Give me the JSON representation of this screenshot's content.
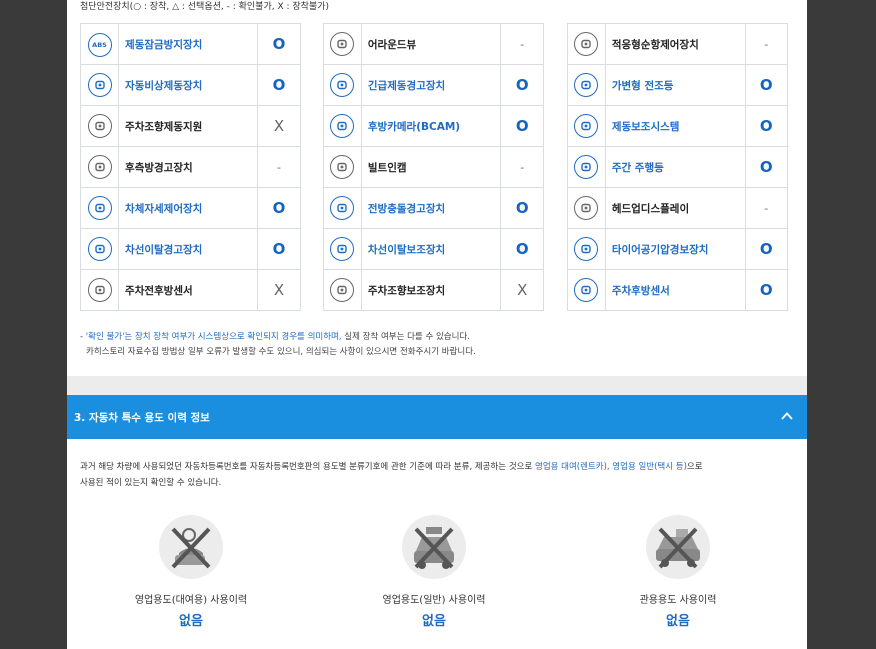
{
  "legend": "첨단안전장치(○ : 장착, △ : 선택옵션, - : 확인불가, X : 장착불가)",
  "columns": [
    [
      {
        "icon": "abs-icon",
        "label": "제동잠금방지장치",
        "status": "O",
        "blue": true
      },
      {
        "icon": "emergency-brake-icon",
        "label": "자동비상제동장치",
        "status": "O",
        "blue": true
      },
      {
        "icon": "steering-wheel-icon",
        "label": "주차조향제동지원",
        "status": "X",
        "blue": false
      },
      {
        "icon": "rear-side-warning-icon",
        "label": "후측방경고장치",
        "status": "-",
        "blue": false
      },
      {
        "icon": "stability-control-icon",
        "label": "차체자세제어장치",
        "status": "O",
        "blue": true
      },
      {
        "icon": "lane-departure-icon",
        "label": "차선이탈경고장치",
        "status": "O",
        "blue": true
      },
      {
        "icon": "parking-sensor-icon",
        "label": "주차전후방센서",
        "status": "X",
        "blue": false
      }
    ],
    [
      {
        "icon": "around-view-icon",
        "label": "어라운드뷰",
        "status": "-",
        "blue": false
      },
      {
        "icon": "emergency-brake-warning-icon",
        "label": "긴급제동경고장치",
        "status": "O",
        "blue": true
      },
      {
        "icon": "rear-camera-icon",
        "label": "후방카메라(BCAM)",
        "status": "O",
        "blue": true
      },
      {
        "icon": "dashcam-icon",
        "label": "빌트인캠",
        "status": "-",
        "blue": false
      },
      {
        "icon": "forward-collision-icon",
        "label": "전방충돌경고장치",
        "status": "O",
        "blue": true
      },
      {
        "icon": "lane-keeping-icon",
        "label": "차선이탈보조장치",
        "status": "O",
        "blue": true
      },
      {
        "icon": "parking-assist-icon",
        "label": "주차조향보조장치",
        "status": "X",
        "blue": false
      }
    ],
    [
      {
        "icon": "adaptive-cruise-icon",
        "label": "적응형순항제어장치",
        "status": "-",
        "blue": false
      },
      {
        "icon": "adaptive-headlight-icon",
        "label": "가변형 전조등",
        "status": "O",
        "blue": true
      },
      {
        "icon": "brake-assist-icon",
        "label": "제동보조시스템",
        "status": "O",
        "blue": true
      },
      {
        "icon": "daytime-running-light-icon",
        "label": "주간 주행등",
        "status": "O",
        "blue": true
      },
      {
        "icon": "head-up-display-icon",
        "label": "헤드업디스플레이",
        "status": "-",
        "blue": false
      },
      {
        "icon": "tire-pressure-icon",
        "label": "타이어공기압경보장치",
        "status": "O",
        "blue": true
      },
      {
        "icon": "rear-sensor-icon",
        "label": "주차후방센서",
        "status": "O",
        "blue": true
      }
    ]
  ],
  "notes": {
    "line1_prefix": "- ",
    "line1_highlight": "'확인 불가'는 장치 장착 여부가 시스템상으로 확인되지 경우를 의미하며,",
    "line1_rest": " 실제 장착 여부는 다를 수 있습니다.",
    "line2": "카히스토리 자료수집 방법상 일부 오류가 발생할 수도 있으니, 의심되는 사항이 있으시면 전화주시기 바랍니다."
  },
  "section": {
    "title": "3. 자동차 특수 용도 이력 정보"
  },
  "description": {
    "line1_prefix": "과거 해당 차량에 사용되었던 자동차등록번호를 자동차등록번호판의 용도별 분류기호에 관한 기준에 따라 분류, 제공하는 것으로 ",
    "line1_highlight": "영업용 대여(렌트카), 영업용 일반(택시 등)",
    "line1_suffix": "으로",
    "line2": "사용된 적이 있는지 확인할 수 있습니다."
  },
  "usage": [
    {
      "icon": "rental-car-icon",
      "label": "영업용도(대여용) 사용이력",
      "value": "없음"
    },
    {
      "icon": "taxi-icon",
      "label": "영업용도(일반) 사용이력",
      "value": "없음"
    },
    {
      "icon": "government-car-icon",
      "label": "관용용도 사용이력",
      "value": "없음"
    }
  ],
  "colors": {
    "accent": "#1a8fe0",
    "link": "#1e6bc4"
  }
}
